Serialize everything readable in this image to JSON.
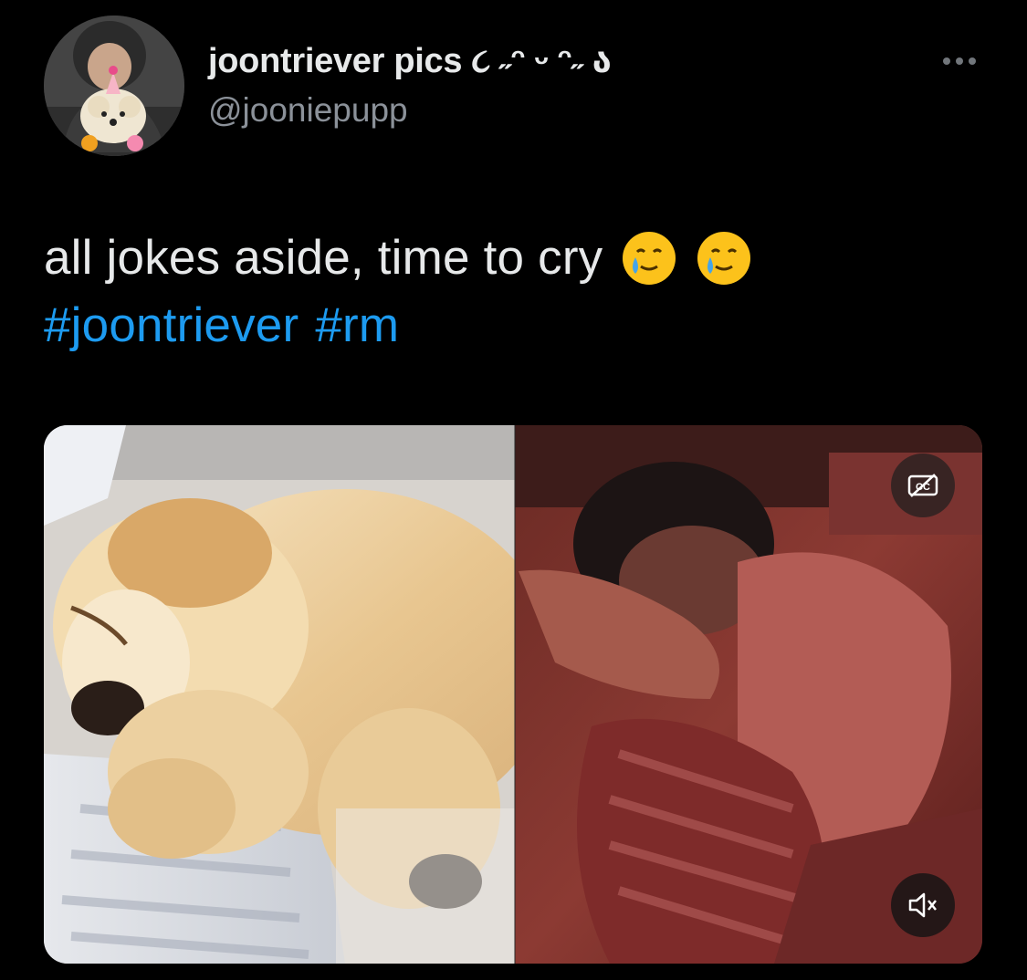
{
  "tweet": {
    "author": {
      "display_name": "joontriever pics ૮ ˶ᵔ ᵕ ᵔ˶ ა",
      "handle": "@jooniepupp",
      "avatar_icon": "profile-avatar"
    },
    "text": "all jokes aside, time to cry",
    "emojis": [
      "🥲",
      "🥲"
    ],
    "hashtags": [
      "#joontriever",
      "#rm"
    ],
    "more_icon": "more-options-icon"
  },
  "media": {
    "type": "video",
    "left_panel": "puppy-sleeping-image",
    "right_panel": "person-sleeping-image",
    "captions_icon": "closed-captions-off-icon",
    "mute_icon": "muted-speaker-icon"
  },
  "colors": {
    "background": "#000000",
    "text": "#e7e9ea",
    "muted_text": "#8b9199",
    "link": "#1d9bf0"
  }
}
